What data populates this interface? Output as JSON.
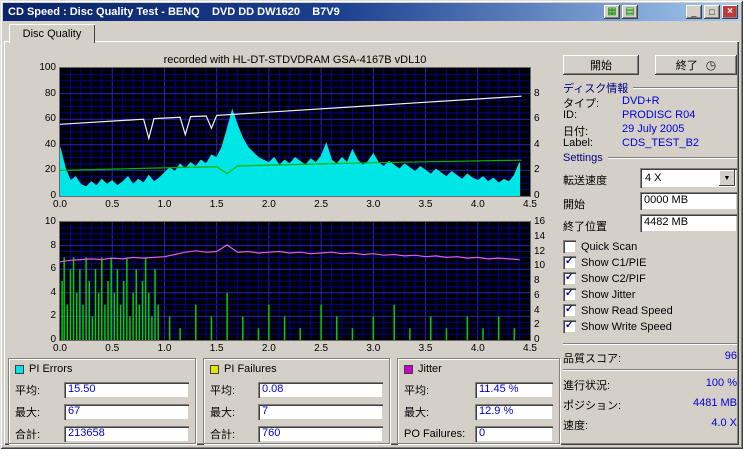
{
  "window": {
    "title": "CD Speed : Disc Quality Test - BENQ    DVD DD DW1620    B7V9"
  },
  "icons": {
    "chart": "▦",
    "grid": "▤",
    "minimize": "_",
    "maximize": "□",
    "close": "×",
    "clock": "◷",
    "dropdown_arrow": "▼",
    "check": "✓"
  },
  "tab": {
    "label": "Disc Quality"
  },
  "chart_header": "recorded with HL-DT-STDVDRAM GSA-4167B vDL10",
  "buttons": {
    "start": "開始",
    "stop": "終了"
  },
  "disc_info": {
    "heading": "ディスク情報",
    "rows": [
      {
        "label": "タイプ:",
        "value": "DVD+R"
      },
      {
        "label": "ID:",
        "value": "PRODISC R04"
      },
      {
        "label": "日付:",
        "value": "29 July 2005"
      },
      {
        "label": "Label:",
        "value": "CDS_TEST_B2"
      }
    ]
  },
  "settings": {
    "heading": "Settings",
    "speed_label": "転送速度",
    "speed_value": "4 X",
    "start_label": "開始",
    "start_value": "0000 MB",
    "end_label": "終了位置",
    "end_value": "4482 MB",
    "checkboxes": [
      {
        "label": "Quick Scan",
        "checked": false
      },
      {
        "label": "Show C1/PIE",
        "checked": true
      },
      {
        "label": "Show C2/PIF",
        "checked": true
      },
      {
        "label": "Show Jitter",
        "checked": true
      },
      {
        "label": "Show Read Speed",
        "checked": true
      },
      {
        "label": "Show Write Speed",
        "checked": true
      }
    ]
  },
  "status": {
    "score_label": "品質スコア:",
    "score_value": "96",
    "progress_label": "進行状況:",
    "progress_value": "100 %",
    "position_label": "ポジション:",
    "position_value": "4481 MB",
    "speed_label": "速度:",
    "speed_value": "4.0 X"
  },
  "stats_boxes": [
    {
      "name": "PI Errors",
      "color": "#00e5e5",
      "rows": [
        {
          "label": "平均:",
          "value": "15.50"
        },
        {
          "label": "最大:",
          "value": "67"
        },
        {
          "label": "合計:",
          "value": "213658"
        }
      ]
    },
    {
      "name": "PI Failures",
      "color": "#e5e500",
      "rows": [
        {
          "label": "平均:",
          "value": "0.08"
        },
        {
          "label": "最大:",
          "value": "7"
        },
        {
          "label": "合計:",
          "value": "760"
        }
      ]
    },
    {
      "name": "Jitter",
      "color": "#cc00cc",
      "rows": [
        {
          "label": "平均:",
          "value": "11.45 %"
        },
        {
          "label": "最大:",
          "value": "12.9 %"
        },
        {
          "label": "PO Failures:",
          "value": "0"
        }
      ]
    }
  ],
  "chart_data": [
    {
      "type": "area",
      "title": "PI Errors with read/write speed overlay",
      "x_max": 4.5,
      "y_max": 100,
      "x_ticks": [
        "0.0",
        "0.5",
        "1.0",
        "1.5",
        "2.0",
        "2.5",
        "3.0",
        "3.5",
        "4.0",
        "4.5"
      ],
      "y_left_ticks": [
        "100",
        "80",
        "60",
        "40",
        "20",
        "0"
      ],
      "y_right_ticks": [
        "8",
        "6",
        "4",
        "2",
        "0"
      ],
      "y_right_fracs": [
        0.2,
        0.4,
        0.6,
        0.8,
        1.0
      ],
      "grid": {
        "x_minor": 0.1,
        "x_major": 0.5,
        "y_minor": 5,
        "y_major": 20
      },
      "series": [
        {
          "name": "PI Errors",
          "type": "area",
          "color": "#00e5e5",
          "x_step": 0.05,
          "values": [
            38,
            22,
            12,
            15,
            9,
            7,
            11,
            8,
            13,
            9,
            12,
            8,
            11,
            15,
            9,
            13,
            10,
            16,
            11,
            14,
            18,
            22,
            19,
            25,
            21,
            26,
            23,
            28,
            25,
            32,
            30,
            38,
            52,
            67,
            55,
            45,
            38,
            34,
            30,
            28,
            26,
            30,
            24,
            28,
            25,
            30,
            27,
            24,
            29,
            26,
            31,
            41,
            28,
            25,
            30,
            26,
            36,
            28,
            24,
            27,
            33,
            26,
            23,
            27,
            24,
            21,
            25,
            22,
            19,
            23,
            20,
            17,
            21,
            18,
            15,
            19,
            16,
            13,
            17,
            14,
            12,
            15,
            11,
            14,
            10,
            13,
            11,
            16,
            26
          ]
        },
        {
          "name": "Read Speed",
          "type": "line",
          "color": "#00b400",
          "points": [
            [
              0,
              20
            ],
            [
              1.5,
              23
            ],
            [
              1.6,
              17.5
            ],
            [
              1.7,
              23.5
            ],
            [
              3.0,
              26
            ],
            [
              4.42,
              28
            ]
          ]
        },
        {
          "name": "Write Speed",
          "type": "line",
          "color": "#f2f2f2",
          "points": [
            [
              0,
              56
            ],
            [
              0.8,
              60
            ],
            [
              0.85,
              45
            ],
            [
              0.9,
              60.5
            ],
            [
              1.15,
              61.5
            ],
            [
              1.2,
              48
            ],
            [
              1.25,
              62
            ],
            [
              1.4,
              62.5
            ],
            [
              1.45,
              53
            ],
            [
              1.5,
              63
            ],
            [
              4.42,
              78
            ]
          ]
        }
      ]
    },
    {
      "type": "line",
      "title": "PI Failures with Jitter overlay",
      "x_max": 4.5,
      "y_max": 10,
      "x_ticks": [
        "0.0",
        "0.5",
        "1.0",
        "1.5",
        "2.0",
        "2.5",
        "3.0",
        "3.5",
        "4.0",
        "4.5"
      ],
      "y_left_ticks": [
        "10",
        "8",
        "6",
        "4",
        "2",
        "0"
      ],
      "y_right_ticks": [
        "16",
        "14",
        "12",
        "10",
        "8",
        "6",
        "4",
        "2",
        "0"
      ],
      "y_right_fracs": [
        0,
        0.125,
        0.25,
        0.375,
        0.5,
        0.625,
        0.75,
        0.875,
        1
      ],
      "grid": {
        "x_minor": 0.1,
        "x_major": 0.5,
        "y_minor": 0.5,
        "y_major": 2
      },
      "series": [
        {
          "name": "PI Failures",
          "type": "spikes",
          "color": "#00d000",
          "points": [
            [
              0.02,
              5
            ],
            [
              0.04,
              7
            ],
            [
              0.07,
              3
            ],
            [
              0.1,
              6
            ],
            [
              0.13,
              7
            ],
            [
              0.16,
              4
            ],
            [
              0.19,
              6
            ],
            [
              0.22,
              3
            ],
            [
              0.25,
              7
            ],
            [
              0.28,
              5
            ],
            [
              0.31,
              2
            ],
            [
              0.34,
              6
            ],
            [
              0.37,
              4
            ],
            [
              0.4,
              7
            ],
            [
              0.43,
              3
            ],
            [
              0.46,
              5
            ],
            [
              0.49,
              7
            ],
            [
              0.52,
              4
            ],
            [
              0.55,
              6
            ],
            [
              0.58,
              3
            ],
            [
              0.61,
              5
            ],
            [
              0.64,
              7
            ],
            [
              0.67,
              2
            ],
            [
              0.7,
              4
            ],
            [
              0.73,
              6
            ],
            [
              0.76,
              3
            ],
            [
              0.79,
              5
            ],
            [
              0.82,
              7
            ],
            [
              0.85,
              4
            ],
            [
              0.88,
              2
            ],
            [
              0.91,
              6
            ],
            [
              0.94,
              3
            ],
            [
              1.05,
              2
            ],
            [
              1.15,
              1
            ],
            [
              1.3,
              3
            ],
            [
              1.45,
              2
            ],
            [
              1.6,
              4
            ],
            [
              1.75,
              2
            ],
            [
              1.9,
              1
            ],
            [
              2.0,
              3
            ],
            [
              2.15,
              2
            ],
            [
              2.3,
              1
            ],
            [
              2.5,
              3
            ],
            [
              2.65,
              2
            ],
            [
              2.8,
              1
            ],
            [
              3.0,
              2
            ],
            [
              3.2,
              3
            ],
            [
              3.35,
              1
            ],
            [
              3.55,
              2
            ],
            [
              3.7,
              1
            ],
            [
              3.9,
              2
            ],
            [
              4.05,
              1
            ],
            [
              4.2,
              2
            ],
            [
              4.35,
              1
            ]
          ]
        },
        {
          "name": "Jitter",
          "type": "line",
          "color": "#e060e0",
          "x_step": 0.1,
          "scale_max": 16,
          "values": [
            10.6,
            10.8,
            10.9,
            11.0,
            10.9,
            11.1,
            11.0,
            11.2,
            11.1,
            11.2,
            11.3,
            11.6,
            11.9,
            12.1,
            11.9,
            12.0,
            12.9,
            11.9,
            12.0,
            11.8,
            11.9,
            12.0,
            11.8,
            11.9,
            11.7,
            11.8,
            11.9,
            11.7,
            11.8,
            11.6,
            11.7,
            11.5,
            11.6,
            11.4,
            11.5,
            11.3,
            11.4,
            11.2,
            11.3,
            11.1,
            11.2,
            11.0,
            11.1,
            11.0,
            10.9
          ]
        }
      ]
    }
  ]
}
